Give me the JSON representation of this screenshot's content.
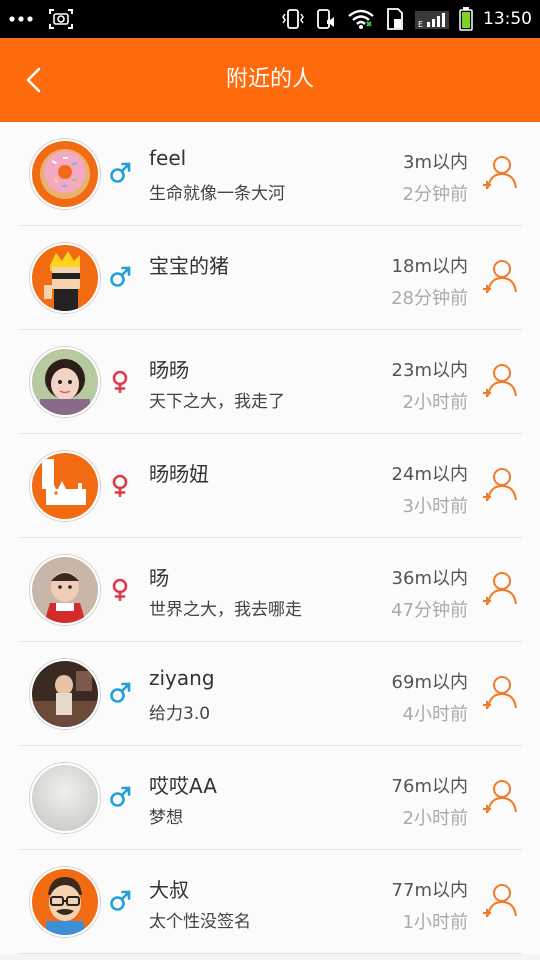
{
  "status_bar": {
    "time": "13:50",
    "signal_label": "E",
    "icons": [
      "more-dots-icon",
      "screenshot-icon",
      "vibrate-icon",
      "silent-icon",
      "wifi-icon",
      "sim-icon",
      "signal-icon",
      "battery-icon"
    ]
  },
  "header": {
    "title": "附近的人",
    "back_icon": "chevron-left-icon"
  },
  "colors": {
    "accent": "#ff6a0c",
    "male": "#1fa0d6",
    "female": "#e03a4a",
    "add_icon": "#f07a2a"
  },
  "users": [
    {
      "name": "feel",
      "signature": "生命就像一条大河",
      "distance": "3m以内",
      "time": "2分钟前",
      "gender": "male",
      "avatar": "donut-avatar"
    },
    {
      "name": "宝宝的猪",
      "signature": "",
      "distance": "18m以内",
      "time": "28分钟前",
      "gender": "male",
      "avatar": "cartoon-boy-avatar"
    },
    {
      "name": "旸旸",
      "signature": "天下之大，我走了",
      "distance": "23m以内",
      "time": "2小时前",
      "gender": "female",
      "avatar": "girl-photo-avatar"
    },
    {
      "name": "旸旸妞",
      "signature": "",
      "distance": "24m以内",
      "time": "3小时前",
      "gender": "female",
      "avatar": "cat-avatar"
    },
    {
      "name": "旸",
      "signature": "世界之大，我去哪走",
      "distance": "36m以内",
      "time": "47分钟前",
      "gender": "female",
      "avatar": "baby-photo-avatar"
    },
    {
      "name": "ziyang",
      "signature": "给力3.0",
      "distance": "69m以内",
      "time": "4小时前",
      "gender": "male",
      "avatar": "child-photo-avatar"
    },
    {
      "name": "哎哎AA",
      "signature": "梦想",
      "distance": "76m以内",
      "time": "2小时前",
      "gender": "male",
      "avatar": "gray-avatar"
    },
    {
      "name": "大叔",
      "signature": "太个性没签名",
      "distance": "77m以内",
      "time": "1小时前",
      "gender": "male",
      "avatar": "uncle-cartoon-avatar"
    }
  ]
}
